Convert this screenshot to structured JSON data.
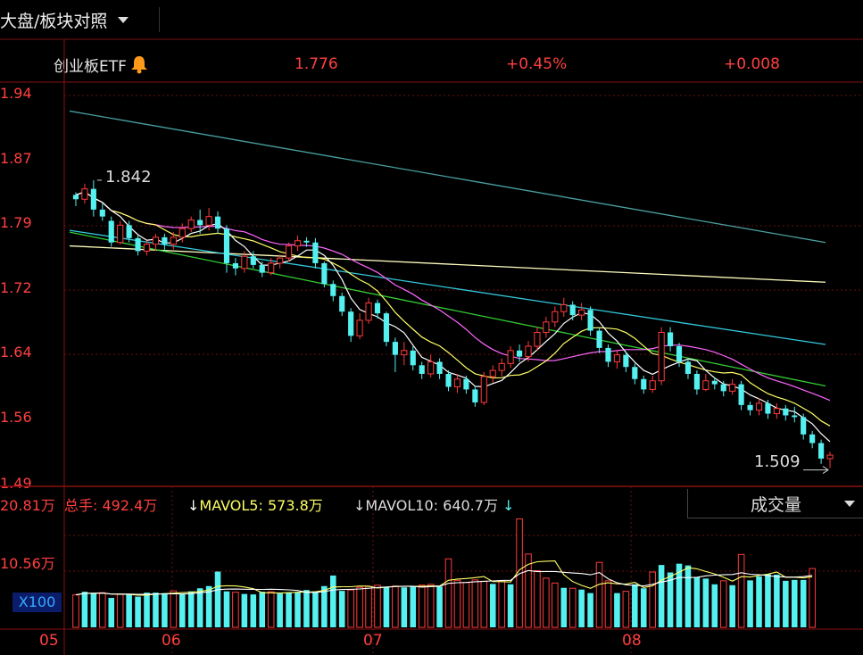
{
  "header": {
    "selector_label": "大盘/板块对照",
    "instrument": "创业板ETF",
    "price": "1.776",
    "change_pct": "+0.45%",
    "change": "+0.008"
  },
  "price_axis": {
    "ticks": [
      "1.94",
      "1.87",
      "1.79",
      "1.72",
      "1.64",
      "1.56",
      "1.49"
    ]
  },
  "annotations": {
    "high_label": "1.842",
    "low_label": "1.509"
  },
  "volume_panel": {
    "total_label": "总手: 492.4万",
    "mavol5_label": "MAVOL5: 573.8万",
    "mavol10_label": "MAVOL10: 640.7万",
    "selector": "成交量",
    "ticks": [
      "20.81万",
      "10.56万",
      "X100"
    ]
  },
  "x_axis": {
    "labels": [
      "05",
      "06",
      "07",
      "08"
    ]
  },
  "colors": {
    "up": "#ff3b3b",
    "down": "#55f0f0",
    "ma5": "#ffffff",
    "ma10": "#ffff66",
    "ma20": "#ff66ff",
    "ma30": "#33cc33",
    "ma60": "#33c8dc",
    "ma120": "#ffffc0",
    "ma250": "#4aa0a0"
  },
  "chart_data": {
    "type": "candlestick",
    "ylim": [
      1.49,
      1.94
    ],
    "candles": [
      [
        1.82,
        1.825,
        1.812,
        1.828,
        0
      ],
      [
        1.82,
        1.832,
        1.815,
        1.838,
        1
      ],
      [
        1.832,
        1.808,
        1.8,
        1.842,
        0
      ],
      [
        1.808,
        1.8,
        1.795,
        1.815,
        0
      ],
      [
        1.795,
        1.77,
        1.765,
        1.8,
        0
      ],
      [
        1.77,
        1.79,
        1.768,
        1.795,
        1
      ],
      [
        1.79,
        1.775,
        1.77,
        1.795,
        0
      ],
      [
        1.775,
        1.76,
        1.755,
        1.778,
        0
      ],
      [
        1.76,
        1.768,
        1.755,
        1.772,
        1
      ],
      [
        1.768,
        1.776,
        1.76,
        1.78,
        1
      ],
      [
        1.776,
        1.768,
        1.76,
        1.78,
        0
      ],
      [
        1.768,
        1.776,
        1.762,
        1.782,
        1
      ],
      [
        1.776,
        1.786,
        1.77,
        1.792,
        1
      ],
      [
        1.786,
        1.796,
        1.782,
        1.8,
        1
      ],
      [
        1.796,
        1.79,
        1.78,
        1.808,
        0
      ],
      [
        1.79,
        1.8,
        1.784,
        1.81,
        1
      ],
      [
        1.8,
        1.786,
        1.78,
        1.806,
        0
      ],
      [
        1.786,
        1.746,
        1.735,
        1.79,
        0
      ],
      [
        1.746,
        1.74,
        1.732,
        1.752,
        0
      ],
      [
        1.74,
        1.754,
        1.735,
        1.76,
        1
      ],
      [
        1.754,
        1.744,
        1.74,
        1.76,
        0
      ],
      [
        1.744,
        1.735,
        1.73,
        1.748,
        0
      ],
      [
        1.735,
        1.746,
        1.732,
        1.752,
        1
      ],
      [
        1.746,
        1.752,
        1.74,
        1.756,
        1
      ],
      [
        1.752,
        1.766,
        1.748,
        1.77,
        1
      ],
      [
        1.766,
        1.772,
        1.76,
        1.778,
        1
      ],
      [
        1.772,
        1.77,
        1.765,
        1.776,
        0
      ],
      [
        1.77,
        1.746,
        1.74,
        1.775,
        0
      ],
      [
        1.746,
        1.722,
        1.718,
        1.748,
        0
      ],
      [
        1.722,
        1.708,
        1.702,
        1.726,
        0
      ],
      [
        1.708,
        1.69,
        1.685,
        1.712,
        0
      ],
      [
        1.69,
        1.662,
        1.655,
        1.694,
        0
      ],
      [
        1.662,
        1.68,
        1.658,
        1.688,
        1
      ],
      [
        1.68,
        1.7,
        1.676,
        1.706,
        1
      ],
      [
        1.7,
        1.688,
        1.682,
        1.704,
        0
      ],
      [
        1.688,
        1.655,
        1.65,
        1.69,
        0
      ],
      [
        1.655,
        1.64,
        1.62,
        1.66,
        0
      ],
      [
        1.64,
        1.645,
        1.628,
        1.655,
        1
      ],
      [
        1.645,
        1.628,
        1.622,
        1.65,
        0
      ],
      [
        1.628,
        1.618,
        1.612,
        1.632,
        0
      ],
      [
        1.618,
        1.632,
        1.614,
        1.64,
        1
      ],
      [
        1.632,
        1.618,
        1.612,
        1.636,
        0
      ],
      [
        1.618,
        1.603,
        1.598,
        1.622,
        0
      ],
      [
        1.603,
        1.612,
        1.596,
        1.618,
        1
      ],
      [
        1.612,
        1.6,
        1.595,
        1.616,
        0
      ],
      [
        1.6,
        1.585,
        1.58,
        1.604,
        0
      ],
      [
        1.585,
        1.615,
        1.582,
        1.62,
        1
      ],
      [
        1.615,
        1.622,
        1.608,
        1.628,
        1
      ],
      [
        1.622,
        1.63,
        1.615,
        1.636,
        1
      ],
      [
        1.63,
        1.645,
        1.625,
        1.65,
        1
      ],
      [
        1.645,
        1.638,
        1.632,
        1.652,
        0
      ],
      [
        1.638,
        1.65,
        1.632,
        1.656,
        1
      ],
      [
        1.65,
        1.666,
        1.645,
        1.672,
        1
      ],
      [
        1.666,
        1.678,
        1.66,
        1.684,
        1
      ],
      [
        1.678,
        1.69,
        1.672,
        1.696,
        1
      ],
      [
        1.69,
        1.698,
        1.684,
        1.706,
        1
      ],
      [
        1.698,
        1.686,
        1.68,
        1.702,
        0
      ],
      [
        1.686,
        1.692,
        1.68,
        1.7,
        1
      ],
      [
        1.692,
        1.668,
        1.662,
        1.696,
        0
      ],
      [
        1.668,
        1.648,
        1.642,
        1.672,
        0
      ],
      [
        1.648,
        1.632,
        1.626,
        1.652,
        0
      ],
      [
        1.632,
        1.64,
        1.624,
        1.646,
        1
      ],
      [
        1.64,
        1.626,
        1.62,
        1.644,
        0
      ],
      [
        1.626,
        1.612,
        1.606,
        1.63,
        0
      ],
      [
        1.612,
        1.6,
        1.595,
        1.616,
        0
      ],
      [
        1.6,
        1.61,
        1.596,
        1.616,
        1
      ],
      [
        1.61,
        1.666,
        1.605,
        1.672,
        1
      ],
      [
        1.666,
        1.65,
        1.644,
        1.672,
        0
      ],
      [
        1.65,
        1.632,
        1.626,
        1.654,
        0
      ],
      [
        1.632,
        1.618,
        1.612,
        1.636,
        0
      ],
      [
        1.618,
        1.6,
        1.594,
        1.622,
        0
      ],
      [
        1.6,
        1.61,
        1.598,
        1.618,
        1
      ],
      [
        1.61,
        1.606,
        1.6,
        1.614,
        0
      ],
      [
        1.606,
        1.598,
        1.592,
        1.61,
        0
      ],
      [
        1.598,
        1.606,
        1.594,
        1.612,
        1
      ],
      [
        1.606,
        1.582,
        1.576,
        1.61,
        0
      ],
      [
        1.582,
        1.576,
        1.57,
        1.586,
        0
      ],
      [
        1.576,
        1.584,
        1.57,
        1.59,
        1
      ],
      [
        1.584,
        1.572,
        1.566,
        1.588,
        0
      ],
      [
        1.572,
        1.578,
        1.566,
        1.584,
        1
      ],
      [
        1.578,
        1.57,
        1.564,
        1.582,
        0
      ],
      [
        1.57,
        1.568,
        1.562,
        1.58,
        0
      ],
      [
        1.568,
        1.548,
        1.542,
        1.572,
        0
      ],
      [
        1.548,
        1.538,
        1.532,
        1.552,
        0
      ],
      [
        1.538,
        1.52,
        1.514,
        1.542,
        0
      ],
      [
        1.52,
        1.524,
        1.509,
        1.528,
        1
      ]
    ],
    "ma_series": [
      {
        "key": "ma250",
        "values": [
          1.922,
          1.77
        ]
      },
      {
        "key": "ma120",
        "values": [
          1.766,
          1.724
        ]
      },
      {
        "key": "ma60",
        "values": [
          1.784,
          1.652
        ]
      },
      {
        "key": "ma30",
        "values": [
          1.782,
          1.604
        ]
      }
    ],
    "volume_ylim": [
      0,
      25
    ],
    "volume": [
      [
        7.4,
        1
      ],
      [
        8.1,
        0
      ],
      [
        7.8,
        0
      ],
      [
        7.9,
        1
      ],
      [
        6.7,
        0
      ],
      [
        7.5,
        1
      ],
      [
        7.6,
        0
      ],
      [
        7.0,
        0
      ],
      [
        7.9,
        0
      ],
      [
        7.9,
        0
      ],
      [
        7.8,
        0
      ],
      [
        8.3,
        1
      ],
      [
        7.7,
        0
      ],
      [
        8.2,
        0
      ],
      [
        8.9,
        0
      ],
      [
        9.4,
        0
      ],
      [
        12.7,
        0
      ],
      [
        8.2,
        0
      ],
      [
        8.0,
        1
      ],
      [
        7.6,
        0
      ],
      [
        7.5,
        0
      ],
      [
        8.1,
        0
      ],
      [
        8.1,
        1
      ],
      [
        7.7,
        0
      ],
      [
        8.0,
        0
      ],
      [
        8.0,
        0
      ],
      [
        8.5,
        0
      ],
      [
        8.2,
        0
      ],
      [
        9.4,
        0
      ],
      [
        11.8,
        0
      ],
      [
        8.3,
        0
      ],
      [
        8.5,
        1
      ],
      [
        9.1,
        1
      ],
      [
        9.3,
        1
      ],
      [
        9.6,
        1
      ],
      [
        9.2,
        0
      ],
      [
        9.4,
        1
      ],
      [
        9.1,
        0
      ],
      [
        9.3,
        0
      ],
      [
        9.6,
        1
      ],
      [
        9.8,
        1
      ],
      [
        9.3,
        0
      ],
      [
        15.6,
        1
      ],
      [
        10.7,
        1
      ],
      [
        10.2,
        1
      ],
      [
        10.8,
        1
      ],
      [
        10.5,
        1
      ],
      [
        9.9,
        0
      ],
      [
        10.6,
        1
      ],
      [
        9.8,
        0
      ],
      [
        24.7,
        1
      ],
      [
        16.7,
        1
      ],
      [
        12.9,
        1
      ],
      [
        11.2,
        1
      ],
      [
        10.1,
        1
      ],
      [
        9.0,
        0
      ],
      [
        8.9,
        1
      ],
      [
        8.6,
        0
      ],
      [
        7.8,
        0
      ],
      [
        14.8,
        1
      ],
      [
        10.6,
        1
      ],
      [
        7.8,
        0
      ],
      [
        8.2,
        1
      ],
      [
        9.8,
        0
      ],
      [
        8.9,
        0
      ],
      [
        12.6,
        1
      ],
      [
        14.2,
        0
      ],
      [
        12.5,
        0
      ],
      [
        14.5,
        0
      ],
      [
        14.1,
        0
      ],
      [
        11.4,
        0
      ],
      [
        11.1,
        0
      ],
      [
        9.8,
        0
      ],
      [
        10.6,
        1
      ],
      [
        9.6,
        0
      ],
      [
        16.6,
        1
      ],
      [
        10.7,
        0
      ],
      [
        11.6,
        0
      ],
      [
        12.1,
        0
      ],
      [
        12.0,
        0
      ],
      [
        10.6,
        0
      ],
      [
        10.8,
        0
      ],
      [
        10.8,
        0
      ],
      [
        13.4,
        1
      ]
    ]
  }
}
